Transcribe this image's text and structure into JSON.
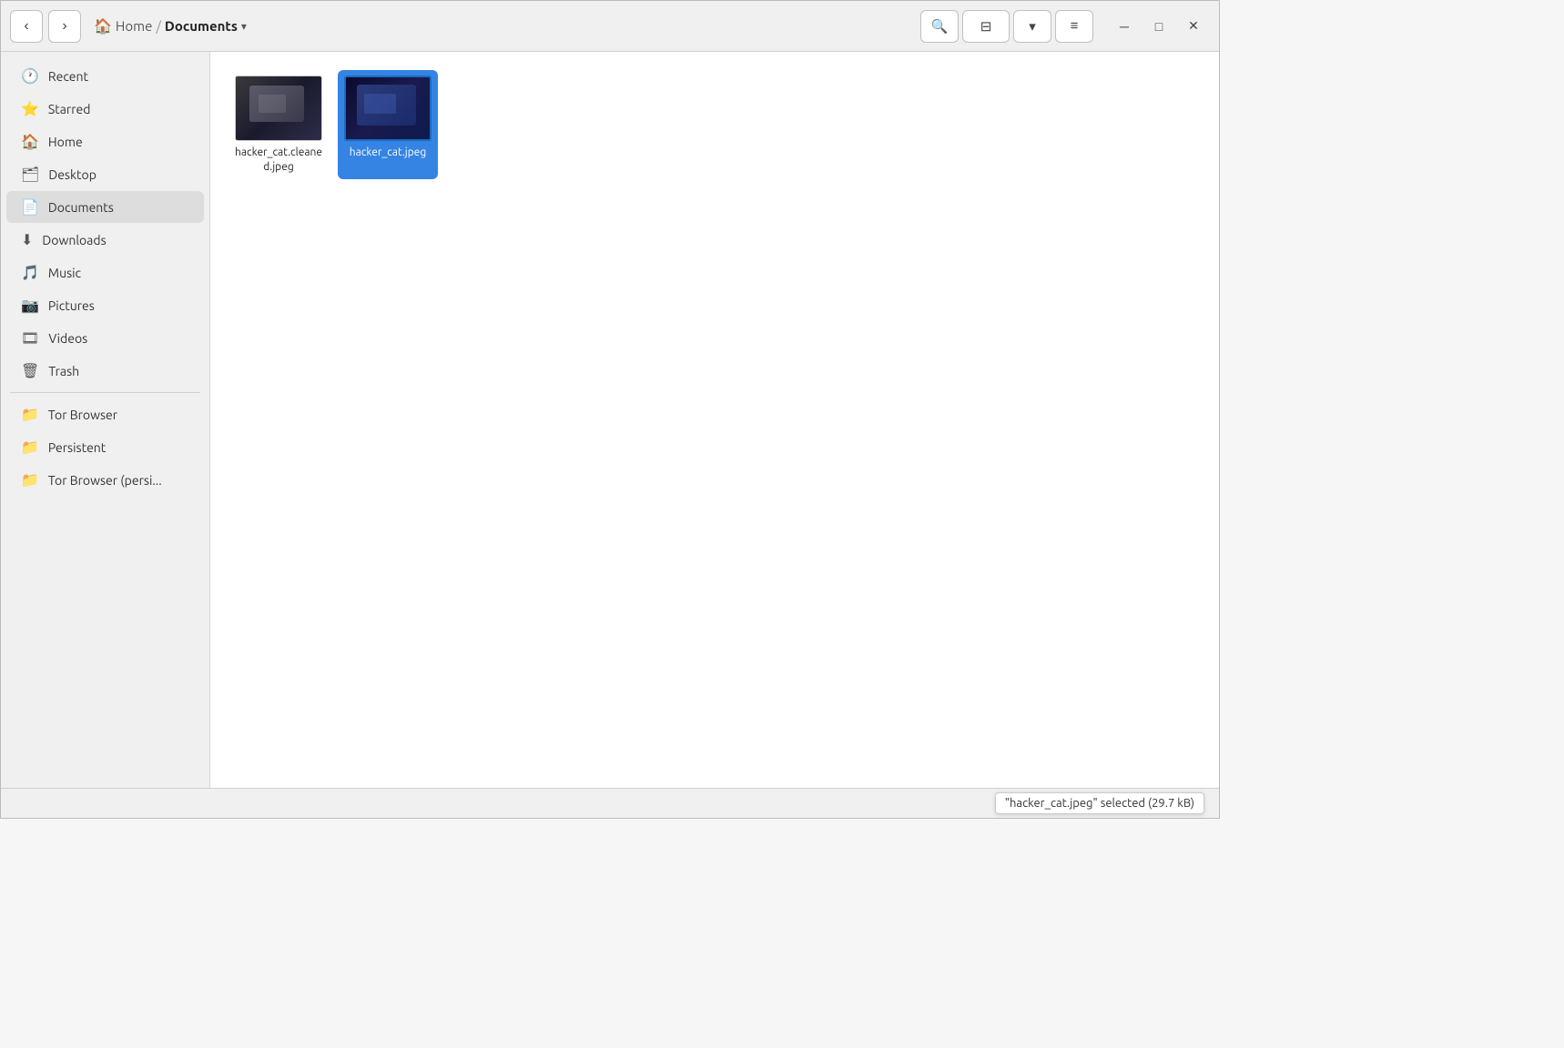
{
  "toolbar": {
    "back_label": "‹",
    "forward_label": "›",
    "home_icon": "🏠",
    "home_label": "Home",
    "separator": "/",
    "current_folder": "Documents",
    "dropdown_arrow": "▾",
    "search_icon": "🔍",
    "list_view_icon": "☰",
    "sort_icon": "▾",
    "menu_icon": "≡",
    "minimize_label": "─",
    "maximize_label": "□",
    "close_label": "✕"
  },
  "sidebar": {
    "items": [
      {
        "id": "recent",
        "label": "Recent",
        "icon": "🕐"
      },
      {
        "id": "starred",
        "label": "Starred",
        "icon": "⭐"
      },
      {
        "id": "home",
        "label": "Home",
        "icon": "🏠"
      },
      {
        "id": "desktop",
        "label": "Desktop",
        "icon": "🗂"
      },
      {
        "id": "documents",
        "label": "Documents",
        "icon": "📄"
      },
      {
        "id": "downloads",
        "label": "Downloads",
        "icon": "⬇"
      },
      {
        "id": "music",
        "label": "Music",
        "icon": "🎵"
      },
      {
        "id": "pictures",
        "label": "Pictures",
        "icon": "📷"
      },
      {
        "id": "videos",
        "label": "Videos",
        "icon": "🎞"
      },
      {
        "id": "trash",
        "label": "Trash",
        "icon": "🗑"
      },
      {
        "id": "tor-browser",
        "label": "Tor Browser",
        "icon": "📁"
      },
      {
        "id": "persistent",
        "label": "Persistent",
        "icon": "📁"
      },
      {
        "id": "tor-browser-persi",
        "label": "Tor Browser (persi...",
        "icon": "📁"
      }
    ]
  },
  "files": [
    {
      "id": "hacker_cat_cleaned",
      "label": "hacker_cat.cleaned.jpeg",
      "selected": false,
      "thumb_class": "thumb-hacker-cat-cleaned"
    },
    {
      "id": "hacker_cat",
      "label": "hacker_cat.jpeg",
      "selected": true,
      "thumb_class": "thumb-hacker-cat"
    }
  ],
  "statusbar": {
    "text": "\"hacker_cat.jpeg\" selected (29.7 kB)"
  }
}
